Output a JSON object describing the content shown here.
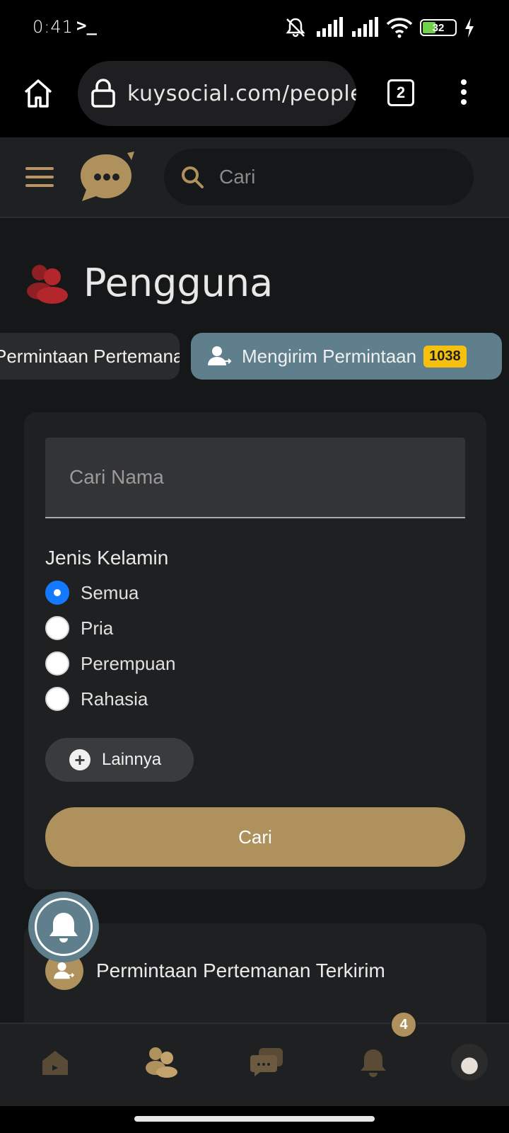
{
  "status_bar": {
    "time": "0:41",
    "terminal_glyph": ">_",
    "battery_level": "32",
    "icons": [
      "mute-vibrate-icon",
      "signal-icon",
      "signal-icon",
      "wifi-icon",
      "battery-icon",
      "charging-icon"
    ]
  },
  "browser": {
    "url": "kuysocial.com/people/sent",
    "tab_count": "2",
    "icons": [
      "home-icon",
      "lock-icon",
      "more-vert-icon"
    ]
  },
  "header": {
    "search_placeholder": "Cari",
    "icons": [
      "hamburger-icon",
      "chat-bubble-logo-icon",
      "search-icon"
    ]
  },
  "page": {
    "title": "Pengguna",
    "title_icon": "users-icon"
  },
  "tabs": [
    {
      "label": "Permintaan Pertemanan",
      "icon": "",
      "active": false
    },
    {
      "label": "Mengirim Permintaan",
      "icon": "user-sent-icon",
      "badge": "1038",
      "active": true
    }
  ],
  "filter": {
    "name_placeholder": "Cari Nama",
    "gender_label": "Jenis Kelamin",
    "gender_options": [
      {
        "label": "Semua",
        "selected": true
      },
      {
        "label": "Pria",
        "selected": false
      },
      {
        "label": "Perempuan",
        "selected": false
      },
      {
        "label": "Rahasia",
        "selected": false
      }
    ],
    "more_label": "Lainnya",
    "search_label": "Cari"
  },
  "sent_requests": {
    "title": "Permintaan Pertemanan Terkirim",
    "icon": "user-sent-icon"
  },
  "bottom_nav": {
    "items": [
      "home-icon",
      "friends-icon",
      "messages-icon",
      "notifications-icon",
      "avatar"
    ],
    "notification_count": "4"
  },
  "colors": {
    "accent_gold": "#af915e",
    "active_tab": "#5f7f8c",
    "badge_yellow": "#f5c00e",
    "radio_blue": "#1479ff",
    "title_icon_red": "#b3262c"
  }
}
